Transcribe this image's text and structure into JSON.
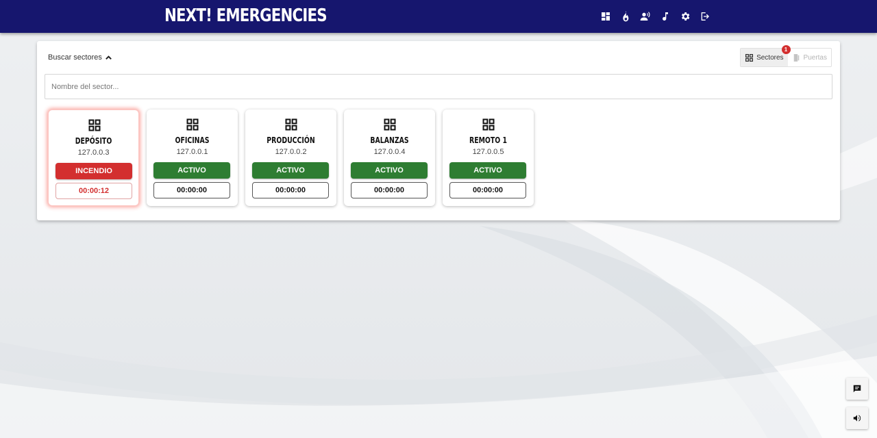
{
  "app": {
    "title": "NEXT! EMERGENCIES"
  },
  "topbar": {
    "icons": [
      "dashboard-icon",
      "fire-icon",
      "voice-icon",
      "music-note-icon",
      "gear-icon",
      "logout-icon"
    ]
  },
  "search": {
    "toggle_label": "Buscar sectores",
    "placeholder": "Nombre del sector..."
  },
  "view_toggle": {
    "sectors_label": "Sectores",
    "sectors_badge": "1",
    "doors_label": "Puertas"
  },
  "sectors": [
    {
      "name": "DEPÓSITO",
      "ip": "127.0.0.3",
      "status": "INCENDIO",
      "timer": "00:00:12"
    },
    {
      "name": "OFICINAS",
      "ip": "127.0.0.1",
      "status": "ACTIVO",
      "timer": "00:00:00"
    },
    {
      "name": "PRODUCCIÓN",
      "ip": "127.0.0.2",
      "status": "ACTIVO",
      "timer": "00:00:00"
    },
    {
      "name": "BALANZAS",
      "ip": "127.0.0.4",
      "status": "ACTIVO",
      "timer": "00:00:00"
    },
    {
      "name": "REMOTO 1",
      "ip": "127.0.0.5",
      "status": "ACTIVO",
      "timer": "00:00:00"
    }
  ],
  "colors": {
    "topbar": "#16166e",
    "active": "#2e7d32",
    "fire": "#d32f2f"
  },
  "fab": {
    "icons": [
      "message-icon",
      "volume-icon"
    ]
  }
}
